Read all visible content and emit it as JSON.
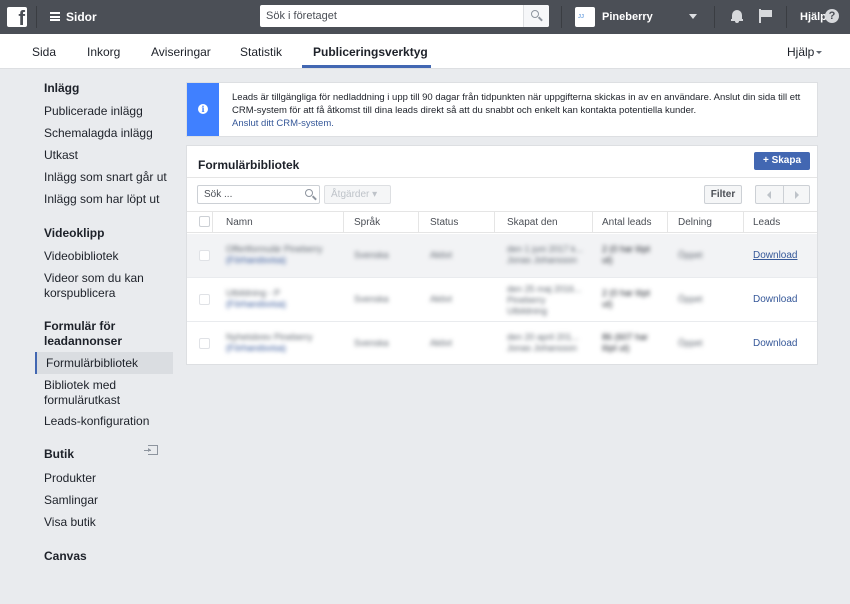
{
  "topbar": {
    "logo": "f",
    "app_title": "Sidor",
    "search_placeholder": "Sök i företaget",
    "page_badge": "ᴊᴊ",
    "page_name": "Pineberry",
    "help_label": "Hjälp",
    "help_glyph": "?"
  },
  "subnav": {
    "tabs": [
      "Sida",
      "Inkorg",
      "Aviseringar",
      "Statistik",
      "Publiceringsverktyg"
    ],
    "active_tab": "Publiceringsverktyg",
    "help_label": "Hjälp"
  },
  "sidebar": {
    "posts": {
      "heading": "Inlägg",
      "items": [
        "Publicerade inlägg",
        "Schemalagda inlägg",
        "Utkast",
        "Inlägg som snart går ut",
        "Inlägg som har löpt ut"
      ]
    },
    "video": {
      "heading": "Videoklipp",
      "items": [
        "Videobibliotek",
        "Videor som du kan",
        "korspublicera"
      ]
    },
    "lead_forms": {
      "heading_l1": "Formulär för",
      "heading_l2": "leadannonser",
      "items": [
        "Formulärbibliotek",
        "Bibliotek med",
        "formulärutkast",
        "Leads-konfiguration"
      ],
      "selected": "Formulärbibliotek"
    },
    "shop": {
      "heading": "Butik",
      "items": [
        "Produkter",
        "Samlingar",
        "Visa butik"
      ]
    },
    "canvas": {
      "heading": "Canvas"
    }
  },
  "notice": {
    "icon": "i",
    "text": "Leads är tillgängliga för nedladdning i upp till 90 dagar från tidpunkten när uppgifterna skickas in av en användare. Anslut din sida till ett CRM-system för att få åtkomst till dina leads direkt så att du snabbt och enkelt kan kontakta potentiella kunder.",
    "link": "Anslut ditt CRM-system."
  },
  "library": {
    "title": "Formulärbibliotek",
    "create_label": "+ Skapa",
    "search_placeholder": "Sök ...",
    "actions_label": "Åtgärder ▾",
    "filter_label": "Filter",
    "columns": [
      "Namn",
      "Språk",
      "Status",
      "Skapat den",
      "Antal leads",
      "Delning",
      "Leads"
    ],
    "rows": [
      {
        "name": "Offertformulär Pineberry",
        "name_sub": "(Förhandsvisa)",
        "lang": "Svenska",
        "status": "Aktivt",
        "created": "den 1 juni 2017 k...",
        "created_sub": "Jonas Johansson",
        "leads": "2 (0 har löpt",
        "leads_sub": "ut)",
        "sharing": "Öppet",
        "download": "Download"
      },
      {
        "name": "Utbildning - P",
        "name_sub": "(Förhandsvisa)",
        "lang": "Svenska",
        "status": "Aktivt",
        "created": "den 25 maj 2016...",
        "created_sub": "Pineberry Utbildning",
        "leads": "2 (0 har löpt",
        "leads_sub": "ut)",
        "sharing": "Öppet",
        "download": "Download"
      },
      {
        "name": "Nyhetsbrev Pineberry",
        "name_sub": "(Förhandsvisa)",
        "lang": "Svenska",
        "status": "Aktivt",
        "created": "den 20 april 201...",
        "created_sub": "Jonas Johansson",
        "leads": "86 (607 har",
        "leads_sub": "löpt ut)",
        "sharing": "Öppet",
        "download": "Download"
      }
    ]
  },
  "colors": {
    "topbar": "#4b4f56",
    "accent": "#4267b2",
    "info": "#4080ff",
    "link": "#365899"
  }
}
